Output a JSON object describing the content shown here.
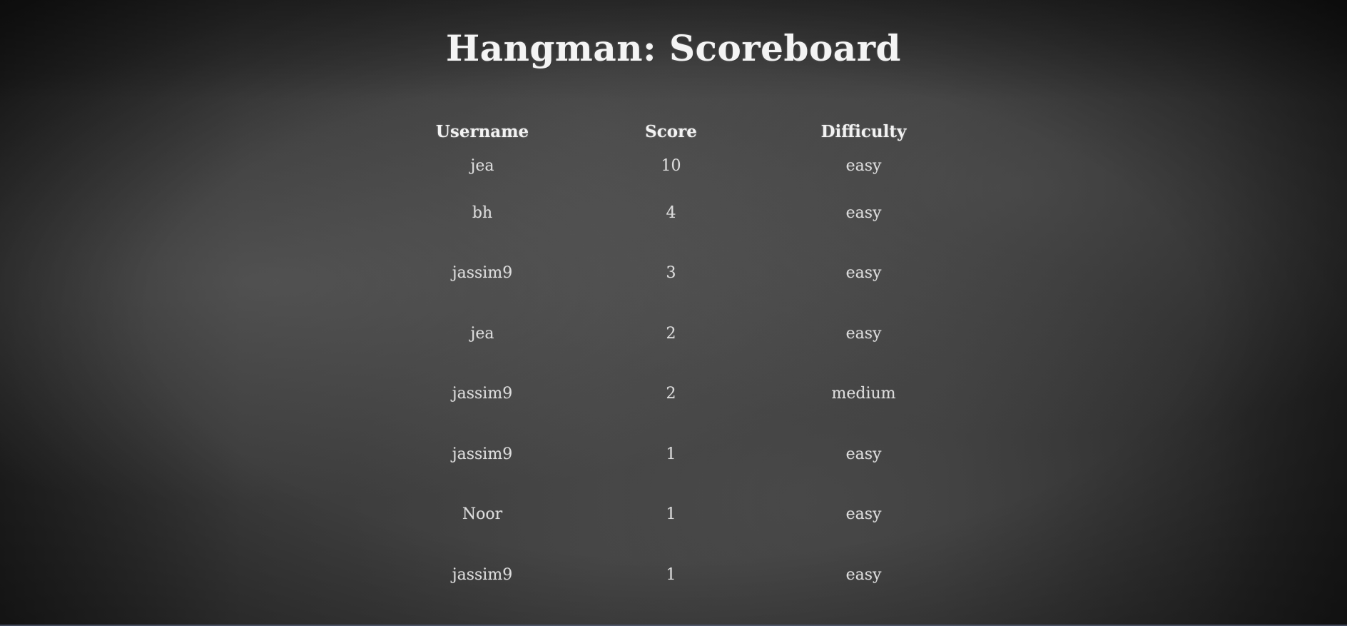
{
  "page": {
    "title": "Hangman: Scoreboard"
  },
  "scoreboard": {
    "headers": {
      "username": "Username",
      "score": "Score",
      "difficulty": "Difficulty"
    },
    "rows": [
      {
        "username": "jea",
        "score": "10",
        "difficulty": "easy"
      },
      {
        "username": "bh",
        "score": "4",
        "difficulty": "easy"
      },
      {
        "username": "jassim9",
        "score": "3",
        "difficulty": "easy"
      },
      {
        "username": "jea",
        "score": "2",
        "difficulty": "easy"
      },
      {
        "username": "jassim9",
        "score": "2",
        "difficulty": "medium"
      },
      {
        "username": "jassim9",
        "score": "1",
        "difficulty": "easy"
      },
      {
        "username": "Noor",
        "score": "1",
        "difficulty": "easy"
      },
      {
        "username": "jassim9",
        "score": "1",
        "difficulty": "easy"
      }
    ]
  },
  "colors": {
    "background": "#3a3a3a",
    "text": "#e8e8e8"
  }
}
